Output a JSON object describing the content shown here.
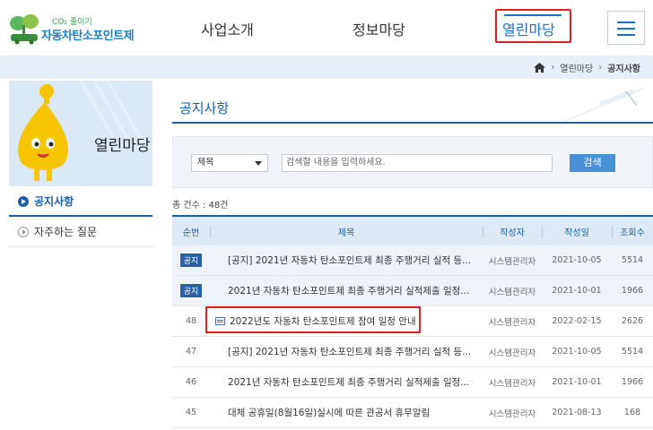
{
  "header": {
    "logo_sub": "CO₂ 줄이기",
    "logo_main": "자동차탄소포인트제",
    "nav": [
      "사업소개",
      "정보마당",
      "열린마당"
    ]
  },
  "breadcrumb": {
    "items": [
      "열린마당",
      "공지사항"
    ]
  },
  "sidebar": {
    "title": "열린마당",
    "items": [
      {
        "label": "공지사항",
        "active": true
      },
      {
        "label": "자주하는 질문",
        "active": false
      }
    ]
  },
  "main": {
    "page_title": "공지사항",
    "search": {
      "select_value": "제목",
      "input_placeholder": "검색할 내용을 입력하세요.",
      "button_label": "검색"
    },
    "total_text": "총 건수 : 48건",
    "table": {
      "headers": [
        "순번",
        "제목",
        "작성자",
        "작성일",
        "조회수"
      ],
      "rows": [
        {
          "num": "공지",
          "badge": true,
          "title": "[공지] 2021년 자동차 탄소포인트제 최종 주행거리 실적 등...",
          "writer": "시스템관리자",
          "date": "2021-10-05",
          "views": "5514"
        },
        {
          "num": "공지",
          "badge": true,
          "title": "2021년 자동차 탄소포인트제 최종 주행거리 실적제출 일정...",
          "writer": "시스템관리자",
          "date": "2021-10-01",
          "views": "1966"
        },
        {
          "num": "48",
          "badge": false,
          "icon": true,
          "title": "2022년도 자동차 탄소포인트제 참여 일정 안내",
          "writer": "시스템관리자",
          "date": "2022-02-15",
          "views": "2626"
        },
        {
          "num": "47",
          "badge": false,
          "title": "[공지] 2021년 자동차 탄소포인트제 최종 주행거리 실적 등...",
          "writer": "시스템관리자",
          "date": "2021-10-05",
          "views": "5514"
        },
        {
          "num": "46",
          "badge": false,
          "title": "2021년 자동차 탄소포인트제 최종 주행거리 실적제출 일정...",
          "writer": "시스템관리자",
          "date": "2021-10-01",
          "views": "1966"
        },
        {
          "num": "45",
          "badge": false,
          "title": "대체 공휴일(8월16일)실시에 따른 관공서 휴무알림",
          "writer": "시스템관리자",
          "date": "2021-08-13",
          "views": "168"
        }
      ]
    }
  },
  "colors": {
    "accent": "#1a5ea8",
    "nav_active": "#1a73c9",
    "highlight": "#e0201f"
  }
}
